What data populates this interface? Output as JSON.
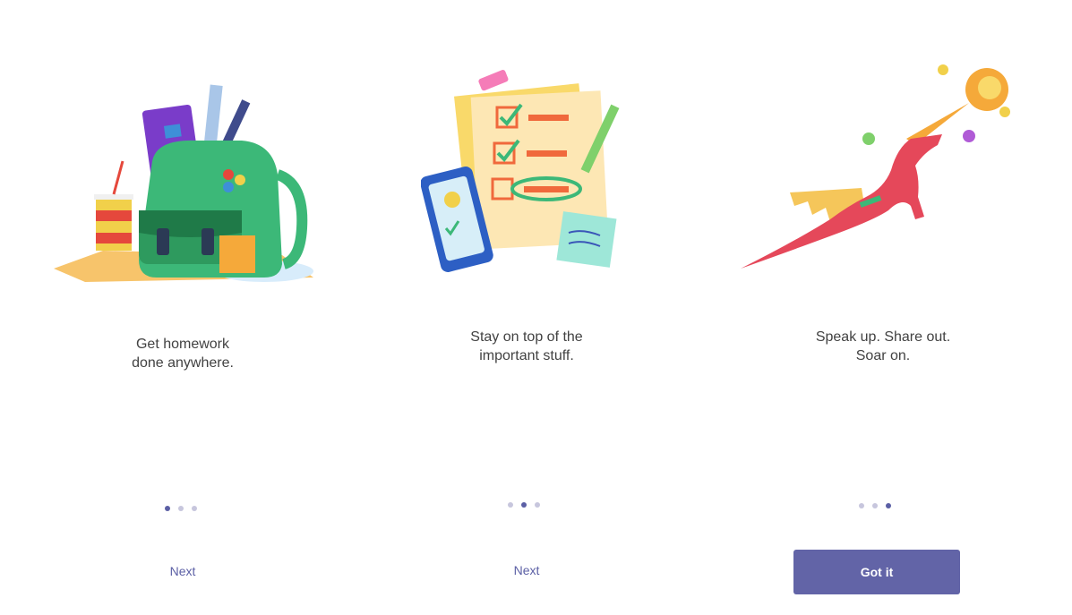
{
  "slides": [
    {
      "illustration": "backpack-illustration",
      "caption_line1": "Get homework",
      "caption_line2": "done anywhere.",
      "active_dot": 1,
      "action_label": "Next"
    },
    {
      "illustration": "checklist-illustration",
      "caption_line1": "Stay on top of the",
      "caption_line2": "important stuff.",
      "active_dot": 2,
      "action_label": "Next"
    },
    {
      "illustration": "dragon-illustration",
      "caption_line1": "Speak up. Share out.",
      "caption_line2": "Soar on.",
      "active_dot": 3,
      "action_label": "Got it"
    }
  ],
  "colors": {
    "accent": "#6264a7",
    "dot_active": "#5b5fa5",
    "dot_inactive": "#c7c6dd"
  }
}
